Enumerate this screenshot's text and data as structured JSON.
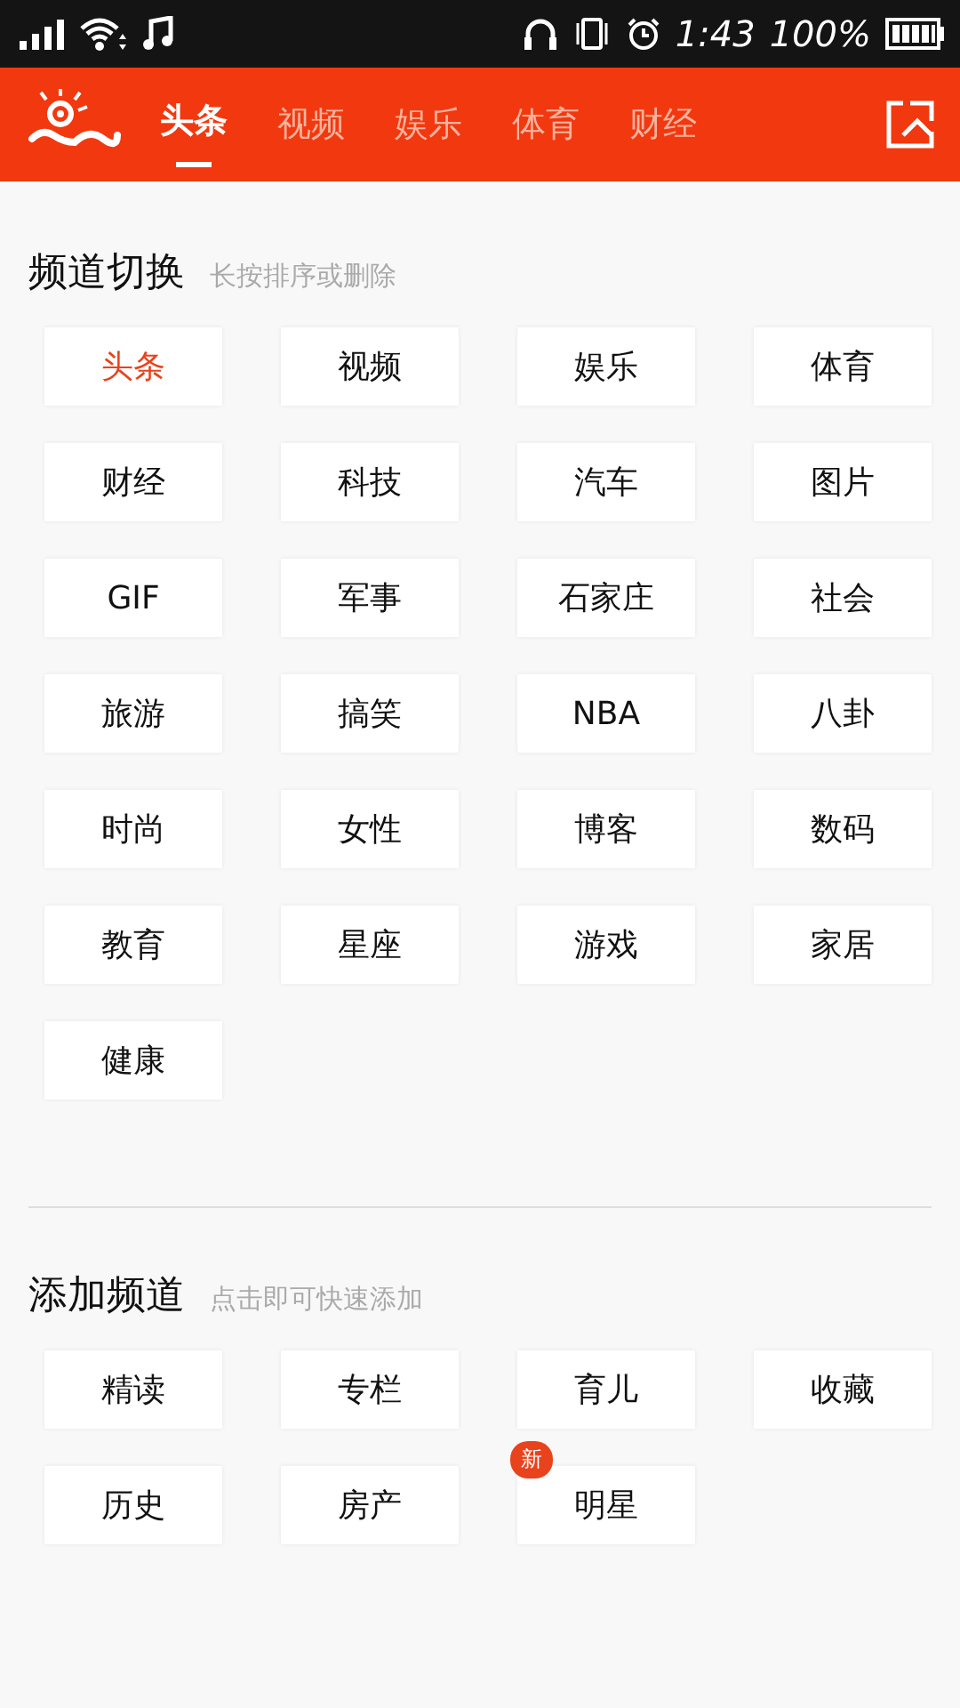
{
  "status_bar": {
    "time": "1:43",
    "battery": "100%"
  },
  "nav": {
    "tabs": [
      {
        "label": "头条",
        "selected": true
      },
      {
        "label": "视频",
        "selected": false
      },
      {
        "label": "娱乐",
        "selected": false
      },
      {
        "label": "体育",
        "selected": false
      },
      {
        "label": "财经",
        "selected": false
      }
    ]
  },
  "sections": [
    {
      "title": "频道切换",
      "hint": "长按排序或删除",
      "channels": [
        {
          "label": "头条",
          "selected": true
        },
        {
          "label": "视频",
          "selected": false
        },
        {
          "label": "娱乐",
          "selected": false
        },
        {
          "label": "体育",
          "selected": false
        },
        {
          "label": "财经",
          "selected": false
        },
        {
          "label": "科技",
          "selected": false
        },
        {
          "label": "汽车",
          "selected": false
        },
        {
          "label": "图片",
          "selected": false
        },
        {
          "label": "GIF",
          "selected": false
        },
        {
          "label": "军事",
          "selected": false
        },
        {
          "label": "石家庄",
          "selected": false
        },
        {
          "label": "社会",
          "selected": false
        },
        {
          "label": "旅游",
          "selected": false
        },
        {
          "label": "搞笑",
          "selected": false
        },
        {
          "label": "NBA",
          "selected": false
        },
        {
          "label": "八卦",
          "selected": false
        },
        {
          "label": "时尚",
          "selected": false
        },
        {
          "label": "女性",
          "selected": false
        },
        {
          "label": "博客",
          "selected": false
        },
        {
          "label": "数码",
          "selected": false
        },
        {
          "label": "教育",
          "selected": false
        },
        {
          "label": "星座",
          "selected": false
        },
        {
          "label": "游戏",
          "selected": false
        },
        {
          "label": "家居",
          "selected": false
        },
        {
          "label": "健康",
          "selected": false
        }
      ]
    },
    {
      "title": "添加频道",
      "hint": "点击即可快速添加",
      "channels": [
        {
          "label": "精读",
          "selected": false
        },
        {
          "label": "专栏",
          "selected": false
        },
        {
          "label": "育儿",
          "selected": false
        },
        {
          "label": "收藏",
          "selected": false
        },
        {
          "label": "历史",
          "selected": false
        },
        {
          "label": "房产",
          "selected": false
        },
        {
          "label": "明星",
          "selected": false,
          "badge": "新"
        }
      ]
    }
  ]
}
